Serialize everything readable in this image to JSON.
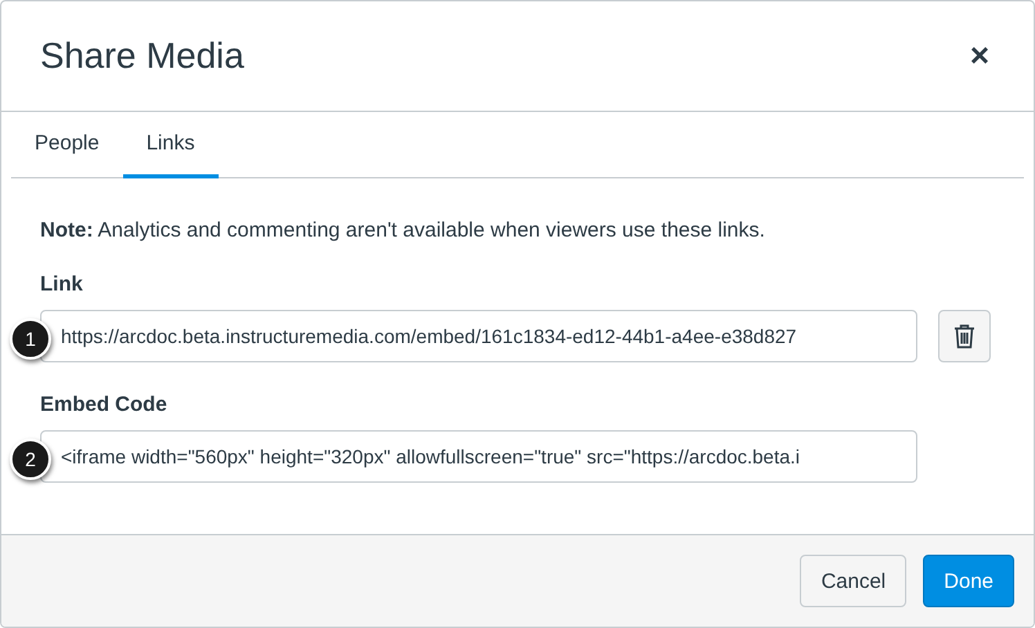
{
  "dialog": {
    "title": "Share Media",
    "close": "×"
  },
  "tabs": [
    {
      "label": "People",
      "selected": false
    },
    {
      "label": "Links",
      "selected": true
    }
  ],
  "note": "**Note:** Analytics and commenting aren't available when viewers use these links.",
  "fields": [
    {
      "label": "Link",
      "value": "https://arcdoc.beta.instructuremedia.com/embed/161c1834-ed12-44b1-a4ee-e38d827",
      "callout": "1",
      "deletable": true
    },
    {
      "label": "Embed Code",
      "value": "<iframe width=\"560px\" height=\"320px\" allowfullscreen=\"true\" src=\"https://arcdoc.beta.i",
      "callout": "2",
      "deletable": false
    }
  ],
  "buttons": [
    {
      "label": "Cancel",
      "kind": "secondary"
    },
    {
      "label": "Done",
      "kind": "primary"
    }
  ]
}
